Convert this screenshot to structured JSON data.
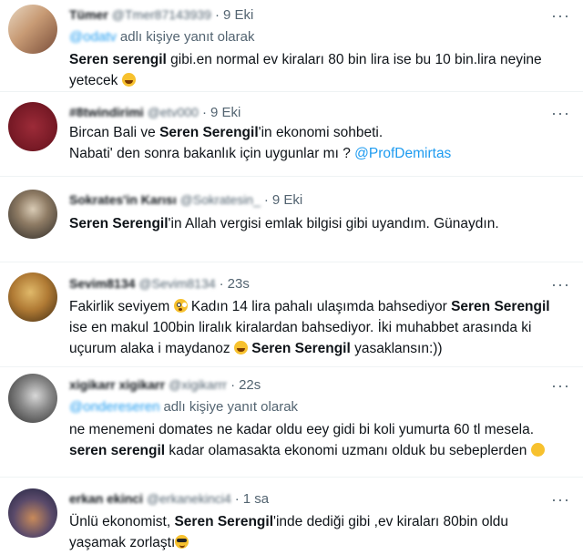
{
  "tweets": [
    {
      "name": "Tümer",
      "handle": "@Tmer87143939",
      "time": "9 Eki",
      "reply_mention": "@odatv",
      "reply_text": "adlı kişiye yanıt olarak",
      "line1_bold": "Seren serengil",
      "line1_rest": " gibi.en normal ev kiraları 80 bin lira ise bu 10 bin.lira neyine",
      "line2": "yetecek",
      "emoji": "grinning-sweat-emoji"
    },
    {
      "name": "#8twindirimi",
      "handle": "@etv000",
      "time": "9 Eki",
      "line1_pre": "Bircan Bali ve ",
      "line1_bold": "Seren Serengil",
      "line1_rest": "'in ekonomi sohbeti.",
      "line2_pre": "Nabati' den sonra bakanlık için uygunlar mı ? ",
      "line2_link": "@ProfDemirtas"
    },
    {
      "name": "Sokrates'in Karısı",
      "handle": "@Sokratesin_",
      "time": "9 Eki",
      "line1_bold": "Seren Serengil",
      "line1_rest": "'in Allah vergisi emlak bilgisi gibi uyandım. Günaydın."
    },
    {
      "name": "Sevim8134",
      "handle": "@Sevim8134",
      "time": "23s",
      "line1_pre": "Fakirlik seviyem ",
      "line1_mid": " Kadın 14 lira pahalı ulaşımda bahsediyor ",
      "line1_bold": "Seren Serengil",
      "line2": "ise en makul 100bin liralık kiralardan bahsediyor. İki muhabbet arasında ki",
      "line3_pre": "uçurum alaka i maydanoz ",
      "line3_bold": "Seren Serengil",
      "line3_rest": " yasaklansın:))"
    },
    {
      "name": "xigikarr xigikarr",
      "handle": "@xigikarrr",
      "time": "22s",
      "reply_mention": "@ondereseren",
      "reply_text": "adlı kişiye yanıt olarak",
      "line1": "ne menemeni domates ne kadar oldu eey gidi bi koli yumurta 60 tl mesela.",
      "line2_bold": "seren serengil",
      "line2_rest": " kadar olamasakta ekonomi uzmanı olduk bu sebeplerden"
    },
    {
      "name": "erkan ekinci",
      "handle": "@erkanekinci4",
      "time": "1 sa",
      "line1_pre": "Ünlü ekonomist, ",
      "line1_bold": "Seren Serengil",
      "line1_rest": "'inde dediği gibi ,ev kiraları 80bin oldu",
      "line2": "yaşamak zorlaştı"
    }
  ],
  "more_glyph": "···",
  "dot_glyph": "·",
  "colors": {
    "accent": "#1d9bf0",
    "secondary": "#536471",
    "text": "#0f1419"
  }
}
